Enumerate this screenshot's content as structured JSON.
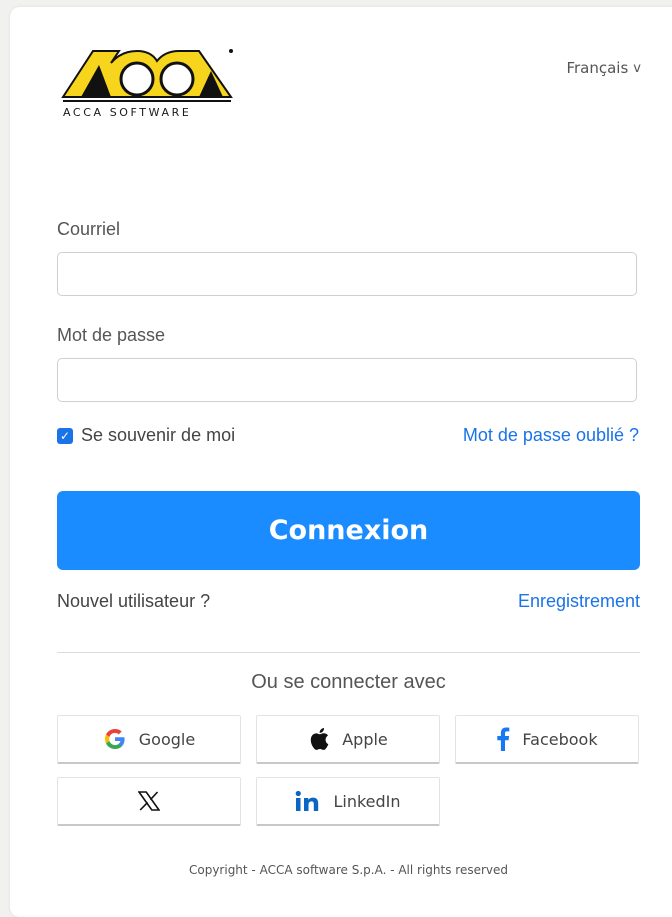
{
  "brand": {
    "name": "ACCA",
    "caption": "ACCA SOFTWARE",
    "logo_color": "#f7d51d"
  },
  "language": {
    "selected": "Français",
    "chevron": "v"
  },
  "form": {
    "email_label": "Courriel",
    "email_value": "",
    "password_label": "Mot de passe",
    "password_value": "",
    "remember_label": "Se souvenir de moi",
    "remember_checked": true,
    "forgot_label": "Mot de passe oublié ?",
    "login_label": "Connexion"
  },
  "register": {
    "prompt": "Nouvel utilisateur ?",
    "link": "Enregistrement"
  },
  "social": {
    "heading": "Ou se connecter avec",
    "providers": [
      {
        "label": "Google",
        "icon": "google-icon"
      },
      {
        "label": "Apple",
        "icon": "apple-icon"
      },
      {
        "label": "Facebook",
        "icon": "facebook-icon"
      },
      {
        "label": "",
        "icon": "x-icon"
      },
      {
        "label": "LinkedIn",
        "icon": "linkedin-icon"
      }
    ]
  },
  "footer": {
    "copyright": "Copyright - ACCA software S.p.A. - All rights reserved"
  },
  "colors": {
    "primary": "#1a8cff",
    "link": "#1a73e8",
    "facebook": "#1877f2",
    "linkedin": "#0a66c2"
  }
}
